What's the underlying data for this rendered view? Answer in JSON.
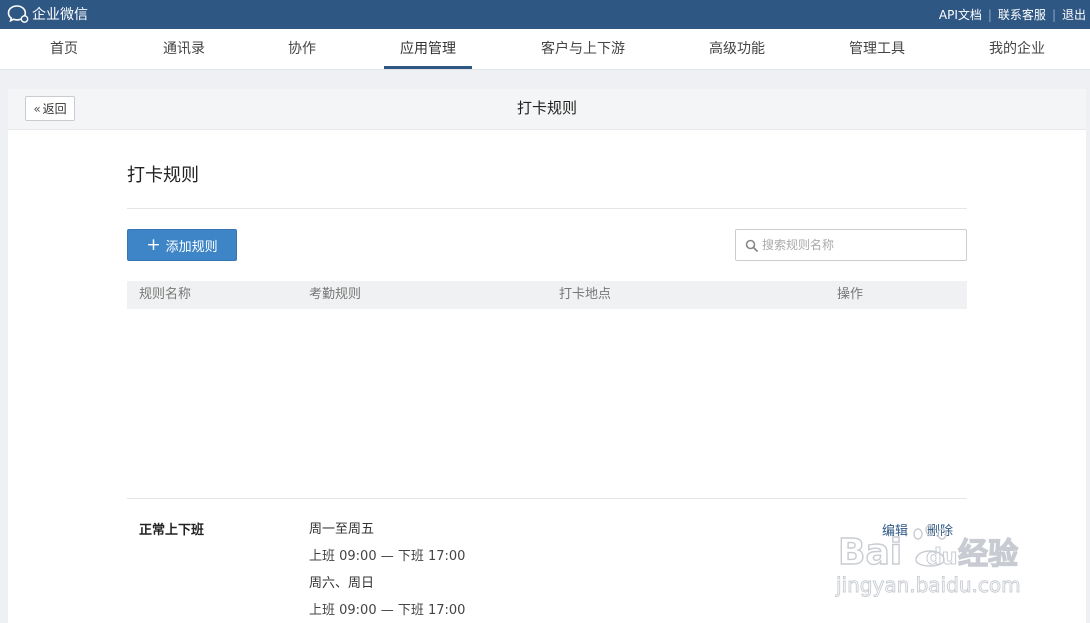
{
  "topbar": {
    "brand": "企业微信",
    "links": [
      "API文档",
      "联系客服",
      "退出"
    ]
  },
  "nav": {
    "items": [
      "首页",
      "通讯录",
      "协作",
      "应用管理",
      "客户与上下游",
      "高级功能",
      "管理工具",
      "我的企业"
    ],
    "active": "应用管理"
  },
  "panel": {
    "back_label": "返回",
    "title": "打卡规则"
  },
  "section": {
    "title": "打卡规则",
    "add_button": "添加规则",
    "search_placeholder": "搜索规则名称"
  },
  "table": {
    "headers": [
      "规则名称",
      "考勤规则",
      "打卡地点",
      "操作"
    ],
    "rows": [
      {
        "name": "正常上下班",
        "rules": [
          {
            "days": "周一至周五",
            "time": "上班 09:00 — 下班 17:00"
          },
          {
            "days": "周六、周日",
            "time": "上班 09:00 — 下班 17:00"
          }
        ],
        "actions": [
          "编辑",
          "删除"
        ]
      }
    ]
  },
  "watermark": {
    "line1": "Baidu经验",
    "line2": "jingyan.baidu.com"
  },
  "colors": {
    "topbar": "#2f5784",
    "accent_button": "#3e85c7",
    "link": "#2f5784"
  }
}
